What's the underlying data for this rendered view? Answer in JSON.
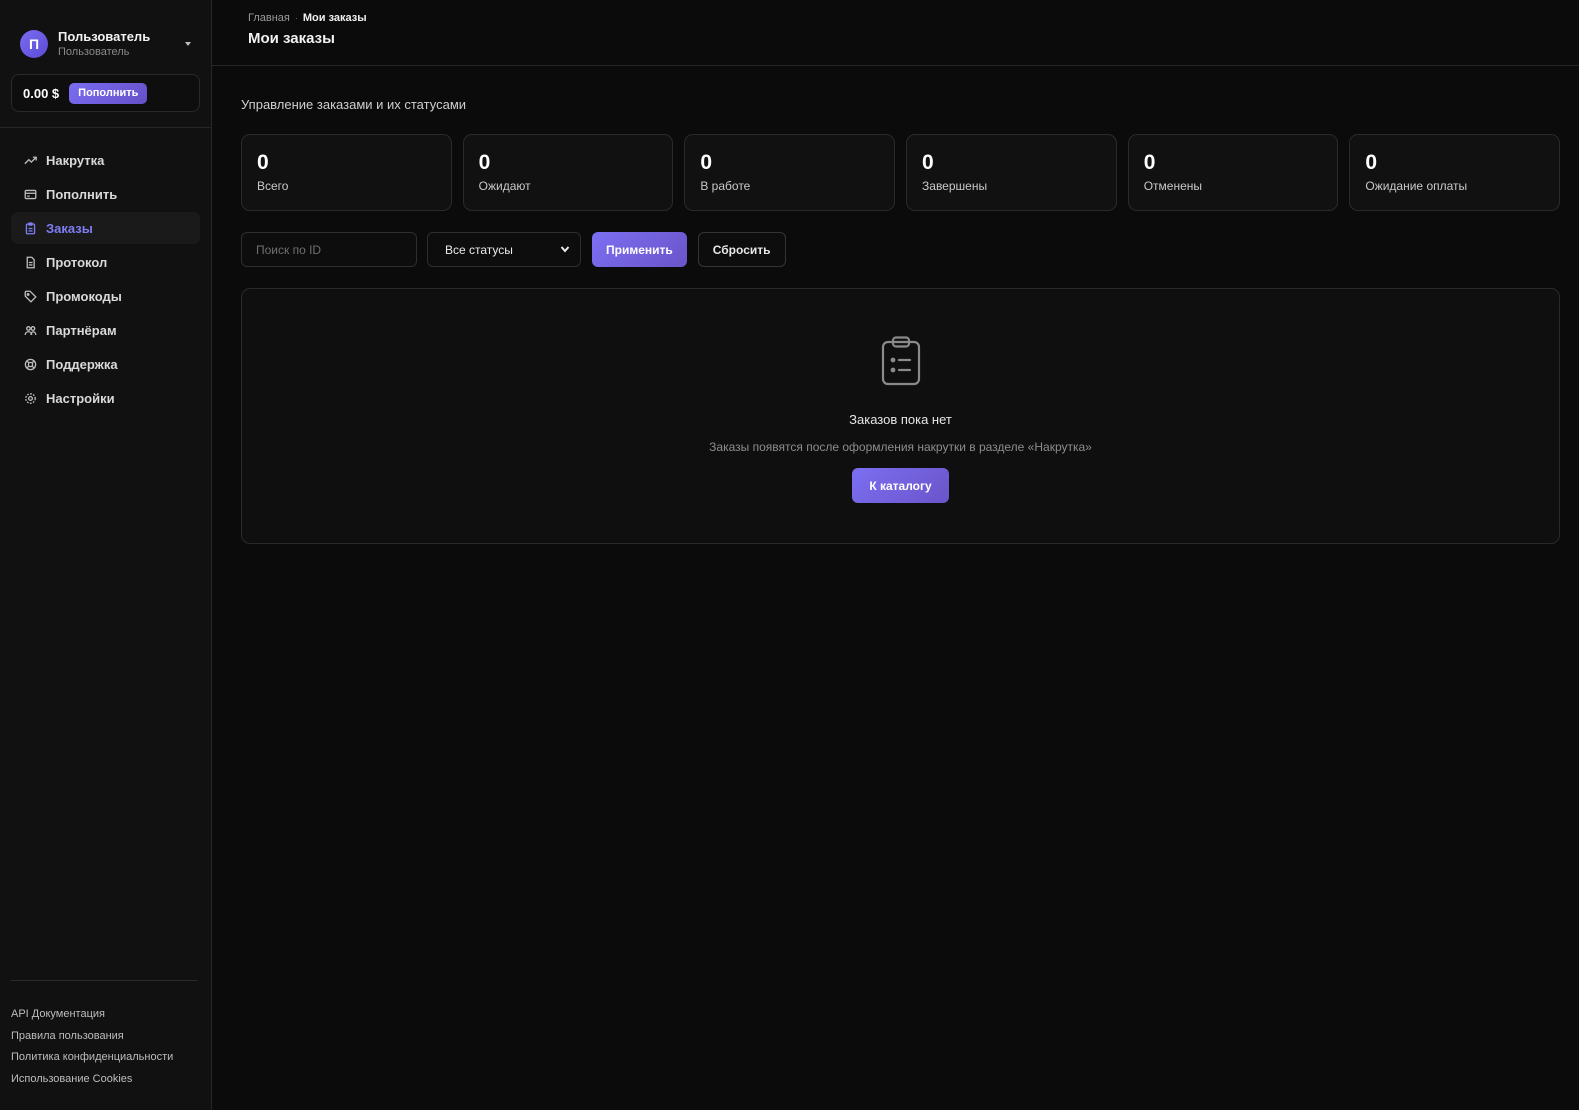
{
  "user": {
    "initial": "П",
    "name": "Пользователь",
    "role": "Пользователь"
  },
  "balance": {
    "amount": "0.00 $",
    "topup_label": "Пополнить"
  },
  "nav": {
    "items": [
      {
        "label": "Накрутка",
        "icon": "trending-up-icon"
      },
      {
        "label": "Пополнить",
        "icon": "credit-card-icon"
      },
      {
        "label": "Заказы",
        "icon": "clipboard-icon",
        "active": true
      },
      {
        "label": "Протокол",
        "icon": "file-text-icon"
      },
      {
        "label": "Промокоды",
        "icon": "tag-icon"
      },
      {
        "label": "Партнёрам",
        "icon": "users-icon"
      },
      {
        "label": "Поддержка",
        "icon": "lifebuoy-icon"
      },
      {
        "label": "Настройки",
        "icon": "gear-icon"
      }
    ]
  },
  "footer": {
    "links": [
      "API Документация",
      "Правила пользования",
      "Политика конфиденциальности",
      "Использование Cookies"
    ]
  },
  "breadcrumb": {
    "home": "Главная",
    "current": "Мои заказы"
  },
  "page": {
    "title": "Мои заказы",
    "subtitle": "Управление заказами и их статусами"
  },
  "stats": [
    {
      "value": "0",
      "label": "Всего"
    },
    {
      "value": "0",
      "label": "Ожидают"
    },
    {
      "value": "0",
      "label": "В работе"
    },
    {
      "value": "0",
      "label": "Завершены"
    },
    {
      "value": "0",
      "label": "Отменены"
    },
    {
      "value": "0",
      "label": "Ожидание оплаты"
    }
  ],
  "filters": {
    "search_placeholder": "Поиск по ID",
    "status_selected": "Все статусы",
    "apply_label": "Применить",
    "reset_label": "Сбросить"
  },
  "empty": {
    "title": "Заказов пока нет",
    "text": "Заказы появятся после оформления накрутки в разделе «Накрутка»",
    "button_label": "К каталогу"
  },
  "colors": {
    "accent": "#7b6ff2",
    "active_nav_text": "#7f7df2",
    "background": "#0b0b0b"
  }
}
